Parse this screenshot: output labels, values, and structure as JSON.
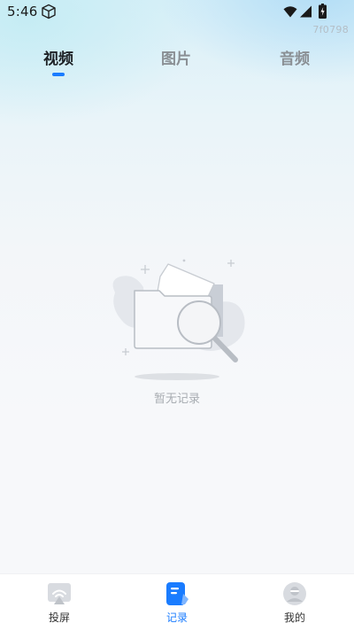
{
  "status_bar": {
    "time": "5:46",
    "icons": [
      "package-icon",
      "wifi-icon",
      "cell-signal-icon",
      "battery-charging-icon"
    ]
  },
  "corner_code": "7f0798",
  "tabs": [
    {
      "label": "视频",
      "active": true
    },
    {
      "label": "图片",
      "active": false
    },
    {
      "label": "音频",
      "active": false
    }
  ],
  "empty_state": {
    "icon": "empty-folder-search-icon",
    "text": "暂无记录"
  },
  "bottom_nav": [
    {
      "label": "投屏",
      "icon": "screen-cast-icon",
      "active": false
    },
    {
      "label": "记录",
      "icon": "record-notes-icon",
      "active": true
    },
    {
      "label": "我的",
      "icon": "profile-avatar-icon",
      "active": false
    }
  ],
  "colors": {
    "accent": "#1a7cff",
    "active_tab_text": "#1e2226",
    "inactive_tab_text": "#8a8f94",
    "empty_text": "#a7acb1"
  }
}
